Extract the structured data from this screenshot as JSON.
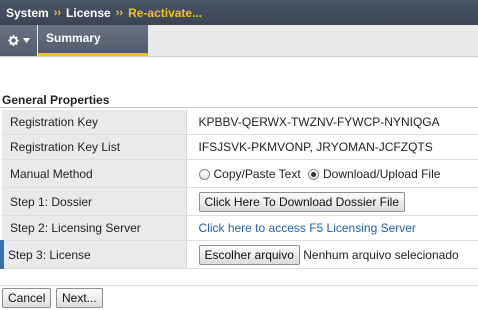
{
  "breadcrumb": {
    "items": [
      "System",
      "License"
    ],
    "separator": "››",
    "current": "Re-activate..."
  },
  "tabs": {
    "summary_label": "Summary"
  },
  "section": {
    "title": "General Properties"
  },
  "properties": {
    "registration_key": {
      "label": "Registration Key",
      "value": "KPBBV-QERWX-TWZNV-FYWCP-NYNIQGA"
    },
    "registration_key_list": {
      "label": "Registration Key List",
      "value": "IFSJSVK-PKMVONP, JRYOMAN-JCFZQTS"
    },
    "manual_method": {
      "label": "Manual Method",
      "options": [
        "Copy/Paste Text",
        "Download/Upload File"
      ],
      "selected": "Download/Upload File"
    },
    "step1": {
      "label": "Step 1: Dossier",
      "button_label": "Click Here To Download Dossier File"
    },
    "step2": {
      "label": "Step 2: Licensing Server",
      "link_text": "Click here to access F5 Licensing Server"
    },
    "step3": {
      "label": "Step 3: License",
      "file_button_label": "Escolher arquivo",
      "file_status": "Nenhum arquivo selecionado"
    }
  },
  "footer": {
    "cancel_label": "Cancel",
    "next_label": "Next..."
  },
  "colors": {
    "accent": "#f2c21b",
    "header_bg": "#3a4453",
    "link": "#2462a8"
  }
}
